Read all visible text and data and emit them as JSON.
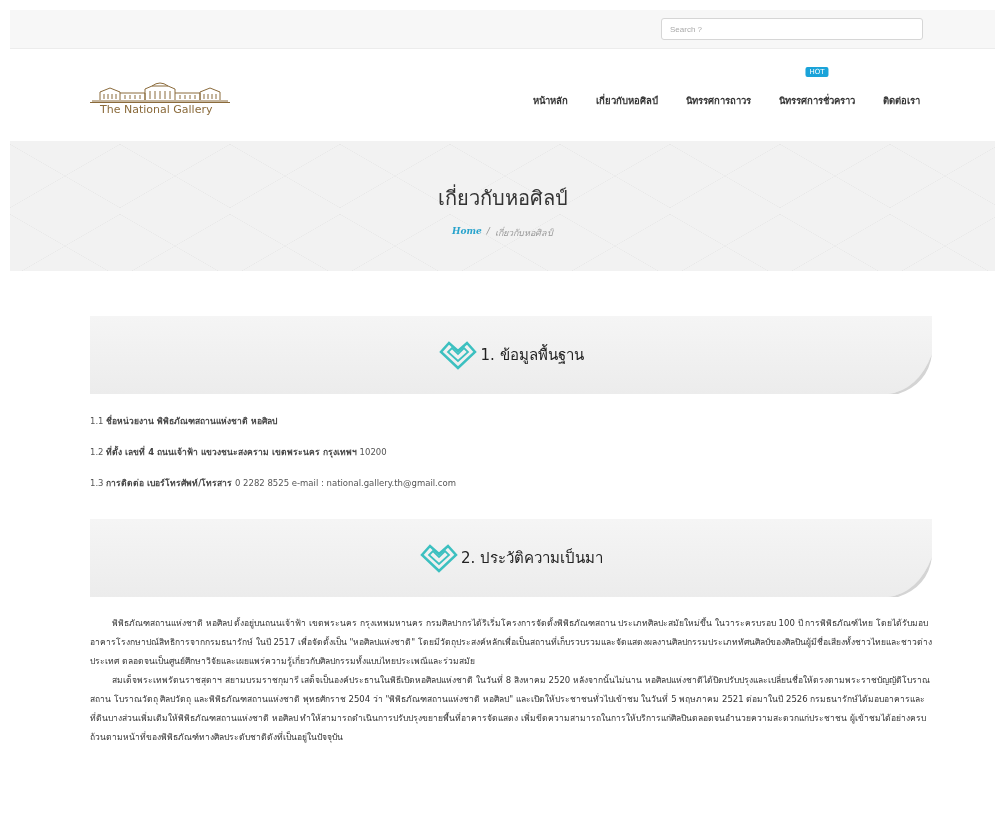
{
  "search": {
    "placeholder": "Search ?"
  },
  "logo": {
    "text": "The National Gallery"
  },
  "nav": [
    {
      "label": "หน้าหลัก"
    },
    {
      "label": "เกี่ยวกับหอศิลป์"
    },
    {
      "label": "นิทรรศการถาวร"
    },
    {
      "label": "นิทรรศการชั่วคราว",
      "badge": "HOT"
    },
    {
      "label": "ติดต่อเรา"
    }
  ],
  "banner": {
    "title": "เกี่ยวกับหอศิลป์",
    "separator": "/",
    "breadcrumb": [
      {
        "label": "Home",
        "kind": "link"
      },
      {
        "label": "เกี่ยวกับหอศิลป์",
        "kind": "current"
      }
    ]
  },
  "sections": [
    {
      "heading": "1. ข้อมูลพื้นฐาน",
      "kind": "lines",
      "items": [
        "1.1 **ชื่อหน่วยงาน พิพิธภัณฑสถานแห่งชาติ หอศิลป**",
        "1.2 **ที่ตั้ง เลขที่ 4 ถนนเจ้าฟ้า แขวงชนะสงคราม เขตพระนคร กรุงเทพฯ** 10200",
        "1.3 **การติดต่อ เบอร์โทรศัพท์/โทรสาร** 0 2282 8525 e-mail : national.gallery.th@gmail.com"
      ]
    },
    {
      "heading": "2. ประวัติความเป็นมา",
      "kind": "paragraphs",
      "items": [
        "พิพิธภัณฑสถานแห่งชาติ หอศิลป ตั้งอยู่บนถนนเจ้าฟ้า เขตพระนคร กรุงเทพมหานคร กรมศิลปากรได้ริเริ่มโครงการจัดตั้งพิพิธภัณฑสถาน ประเภทศิลปะสมัยใหม่ขึ้น ในวาระครบรอบ 100 ปี การพิพิธภัณฑ์ไทย โดยได้รับมอบอาคารโรงกษาปณ์สิทธิการจากกรมธนารักษ์ ในปี 2517 เพื่อจัดตั้งเป็น \"หอศิลปแห่งชาติ\" โดยมีวัตถุประสงค์หลักเพื่อเป็นสถานที่เก็บรวบรวมและจัดแสดงผลงานศิลปกรรมประเภททัศนศิลป์ของศิลปินผู้มีชื่อเสียงทั้งชาวไทยและชาวต่างประเทศ ตลอดจนเป็นศูนย์ศึกษาวิจัยและเผยแพร่ความรู้เกี่ยวกับศิลปกรรมทั้งแบบไทยประเพณีและร่วมสมัย",
        "สมเด็จพระเทพรัตนราชสุดาฯ สยามบรมราชกุมารี เสด็จเป็นองค์ประธานในพิธีเปิดหอศิลปแห่งชาติ ในวันที่ 8 สิงหาคม 2520 หลังจากนั้นไม่นาน หอศิลปแห่งชาติได้ปิดปรับปรุงและเปลี่ยนชื่อให้ตรงตามพระราชบัญญัติโบราณสถาน โบราณวัตถุ ศิลปวัตถุ และพิพิธภัณฑสถานแห่งชาติ พุทธศักราช 2504 ว่า \"พิพิธภัณฑสถานแห่งชาติ หอศิลป\" และเปิดให้ประชาชนทั่วไปเข้าชม ในวันที่ 5 พฤษภาคม 2521 ต่อมาในปี 2526 กรมธนารักษ์ได้มอบอาคารและที่ดินบางส่วนเพิ่มเติมให้พิพิธภัณฑสถานแห่งชาติ หอศิลป ทำให้สามารถดำเนินการปรับปรุงขยายพื้นที่อาคารจัดแสดง เพิ่มขีดความสามารถในการให้บริการแก่ศิลปินตลอดจนอำนวยความสะดวกแก่ประชาชน ผู้เข้าชมได้อย่างครบถ้วนตามหน้าที่ของพิพิธภัณฑ์ทางศิลประดับชาติดังที่เป็นอยู่ในปัจจุบัน"
      ]
    }
  ]
}
